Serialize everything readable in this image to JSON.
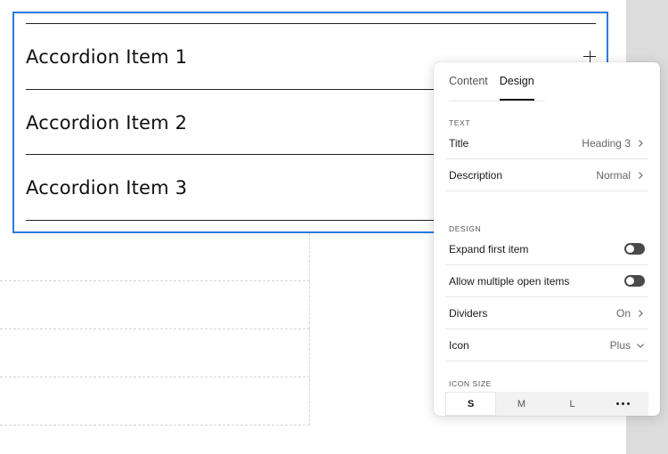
{
  "accordion": {
    "items": [
      {
        "title": "Accordion Item 1",
        "icon": "plus-icon"
      },
      {
        "title": "Accordion Item 2",
        "icon": "plus-icon"
      },
      {
        "title": "Accordion Item 3",
        "icon": "plus-icon"
      }
    ],
    "selection_color": "#2b7be1"
  },
  "panel": {
    "tabs": [
      {
        "label": "Content",
        "active": false
      },
      {
        "label": "Design",
        "active": true
      }
    ],
    "sections": {
      "text": "TEXT",
      "design": "DESIGN",
      "icon_size": "ICON SIZE"
    },
    "text_rows": [
      {
        "label": "Title",
        "value": "Heading 3",
        "icon": "chevron-right-icon"
      },
      {
        "label": "Description",
        "value": "Normal",
        "icon": "chevron-right-icon"
      }
    ],
    "design_rows": {
      "expand_first": {
        "label": "Expand first item",
        "on": false
      },
      "allow_multiple": {
        "label": "Allow multiple open items",
        "on": false
      },
      "dividers": {
        "label": "Dividers",
        "value": "On",
        "icon": "chevron-right-icon"
      },
      "icon": {
        "label": "Icon",
        "value": "Plus",
        "icon": "chevron-down-icon"
      }
    },
    "icon_sizes": {
      "options": [
        "S",
        "M",
        "L"
      ],
      "selected": "S",
      "more_icon": "more-horizontal-icon"
    }
  }
}
